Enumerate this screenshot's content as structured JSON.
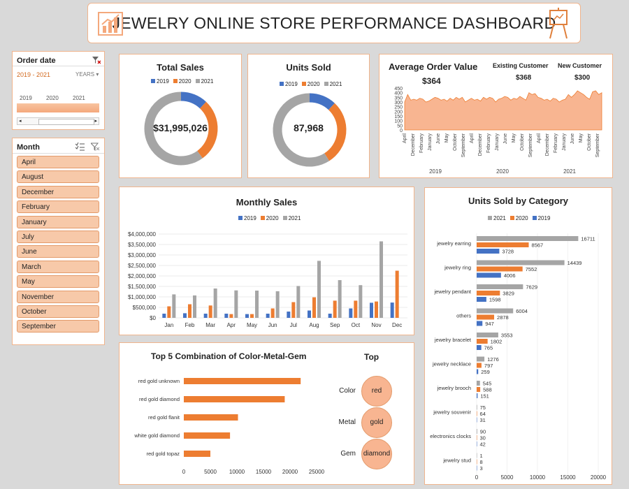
{
  "header": {
    "title": "JEWELRY ONLINE STORE PERFORMANCE DASHBOARD"
  },
  "colors": {
    "y2019": "#4472c4",
    "y2020": "#ed7d31",
    "y2021": "#a5a5a5",
    "accent": "#f4a87c",
    "slicer": "#f7c9a9"
  },
  "order_date_slicer": {
    "title": "Order date",
    "range": "2019 - 2021",
    "unit": "YEARS",
    "years": [
      "2019",
      "2020",
      "2021"
    ]
  },
  "month_slicer": {
    "title": "Month",
    "items": [
      "April",
      "August",
      "December",
      "February",
      "January",
      "July",
      "June",
      "March",
      "May",
      "November",
      "October",
      "September"
    ]
  },
  "total_sales": {
    "title": "Total Sales",
    "value": "$31,995,026",
    "legend": [
      "2019",
      "2020",
      "2021"
    ]
  },
  "units_sold": {
    "title": "Units Sold",
    "value": "87,968",
    "legend": [
      "2019",
      "2020",
      "2021"
    ]
  },
  "aov": {
    "title": "Average Order Value",
    "value": "$364",
    "existing_label": "Existing Customer",
    "existing_value": "$368",
    "new_label": "New Customer",
    "new_value": "$300",
    "y_ticks": [
      "450",
      "400",
      "350",
      "300",
      "250",
      "200",
      "150",
      "100",
      "50",
      "0"
    ],
    "x_labels": [
      "April",
      "December",
      "February",
      "January",
      "June",
      "May",
      "October",
      "September",
      "April",
      "December",
      "February",
      "January",
      "June",
      "May",
      "October",
      "September",
      "April",
      "December",
      "February",
      "January",
      "June",
      "May",
      "October",
      "September"
    ],
    "year_labels": [
      "2019",
      "2020",
      "2021"
    ]
  },
  "monthly_sales": {
    "title": "Monthly Sales",
    "legend": [
      "2019",
      "2020",
      "2021"
    ],
    "y_ticks": [
      "$4,000,000",
      "$3,500,000",
      "$3,000,000",
      "$2,500,000",
      "$2,000,000",
      "$1,500,000",
      "$1,000,000",
      "$500,000",
      "$0"
    ]
  },
  "top5": {
    "title": "Top 5 Combination of Color-Metal-Gem",
    "x_ticks": [
      "0",
      "5000",
      "10000",
      "15000",
      "20000",
      "25000"
    ],
    "top_title": "Top",
    "top_items": [
      {
        "label": "Color",
        "value": "red"
      },
      {
        "label": "Metal",
        "value": "gold"
      },
      {
        "label": "Gem",
        "value": "diamond"
      }
    ]
  },
  "units_by_category": {
    "title": "Units Sold by Category",
    "legend": [
      "2021",
      "2020",
      "2019"
    ],
    "x_ticks": [
      "0",
      "5000",
      "10000",
      "15000",
      "20000"
    ]
  },
  "chart_data": [
    {
      "type": "pie",
      "title": "Total Sales",
      "categories": [
        "2019",
        "2020",
        "2021"
      ],
      "values": [
        0.12,
        0.28,
        0.6
      ]
    },
    {
      "type": "pie",
      "title": "Units Sold",
      "categories": [
        "2019",
        "2020",
        "2021"
      ],
      "values": [
        0.12,
        0.29,
        0.59
      ]
    },
    {
      "type": "area",
      "title": "Average Order Value",
      "ylim": [
        0,
        450
      ],
      "values": [
        300,
        380,
        320,
        330,
        320,
        340,
        330,
        300,
        310,
        330,
        350,
        340,
        320,
        330,
        310,
        340,
        320,
        350,
        330,
        350,
        300,
        320,
        340,
        320,
        330,
        310,
        350,
        330,
        350,
        340,
        300,
        330,
        340,
        360,
        350,
        320,
        340,
        330,
        360,
        340,
        320,
        400,
        380,
        390,
        350,
        340,
        320,
        330,
        310,
        340,
        330,
        300,
        320,
        330,
        380,
        350,
        380,
        420,
        400,
        380,
        350,
        330,
        410,
        420,
        380,
        400
      ]
    },
    {
      "type": "bar",
      "title": "Monthly Sales",
      "categories": [
        "Jan",
        "Feb",
        "Mar",
        "Apr",
        "May",
        "Jun",
        "Jul",
        "Aug",
        "Sep",
        "Oct",
        "Nov",
        "Dec"
      ],
      "ylim": [
        0,
        4000000
      ],
      "series": [
        {
          "name": "2019",
          "values": [
            200000,
            220000,
            200000,
            200000,
            180000,
            200000,
            300000,
            350000,
            200000,
            450000,
            720000,
            730000
          ]
        },
        {
          "name": "2020",
          "values": [
            550000,
            650000,
            590000,
            180000,
            180000,
            450000,
            750000,
            980000,
            820000,
            820000,
            780000,
            2250000
          ]
        },
        {
          "name": "2021",
          "values": [
            1120000,
            1070000,
            1400000,
            1310000,
            1300000,
            1270000,
            1520000,
            2720000,
            1800000,
            1560000,
            3650000,
            0
          ]
        }
      ]
    },
    {
      "type": "bar",
      "title": "Top 5 Combination of Color-Metal-Gem",
      "categories": [
        "red gold unknown",
        "red gold diamond",
        "red gold flanit",
        "white gold diamond",
        "red gold topaz"
      ],
      "values": [
        22000,
        19000,
        10200,
        8700,
        5000
      ],
      "xlim": [
        0,
        25000
      ]
    },
    {
      "type": "bar",
      "title": "Units Sold by Category",
      "categories": [
        "jewelry earring",
        "jewelry ring",
        "jewelry pendant",
        "others",
        "jewelry bracelet",
        "jewelry necklace",
        "jewelry brooch",
        "jewelry souvenir",
        "electronics clocks",
        "jewelry stud"
      ],
      "xlim": [
        0,
        20000
      ],
      "series": [
        {
          "name": "2021",
          "values": [
            16711,
            14439,
            7629,
            6004,
            3553,
            1276,
            545,
            75,
            90,
            1
          ]
        },
        {
          "name": "2020",
          "values": [
            8567,
            7552,
            3829,
            2878,
            1802,
            797,
            588,
            64,
            30,
            8
          ]
        },
        {
          "name": "2019",
          "values": [
            3728,
            4006,
            1598,
            947,
            765,
            259,
            151,
            31,
            42,
            3
          ]
        }
      ]
    }
  ]
}
